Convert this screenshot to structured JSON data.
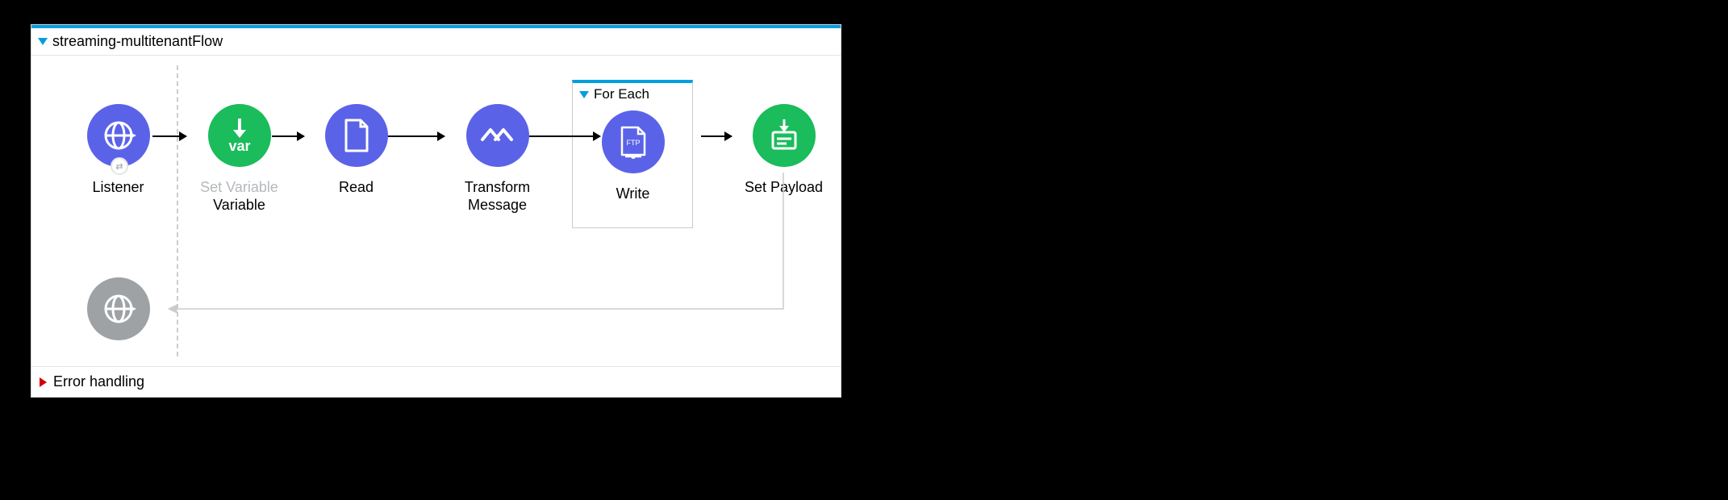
{
  "flow": {
    "title": "streaming-multitenantFlow",
    "foreach_label": "For Each",
    "error_label": "Error handling"
  },
  "nodes": {
    "listener": {
      "label": "Listener"
    },
    "setvar": {
      "label": "Set Variable",
      "sublabel": "Variable"
    },
    "read": {
      "label": "Read"
    },
    "transform": {
      "label": "Transform",
      "sublabel": "Message"
    },
    "write": {
      "label": "Write"
    },
    "setpayload": {
      "label": "Set Payload"
    }
  },
  "colors": {
    "purple": "#5a63e7",
    "green": "#1abc5b",
    "grey": "#9ea2a5",
    "accent": "#00a0df"
  }
}
